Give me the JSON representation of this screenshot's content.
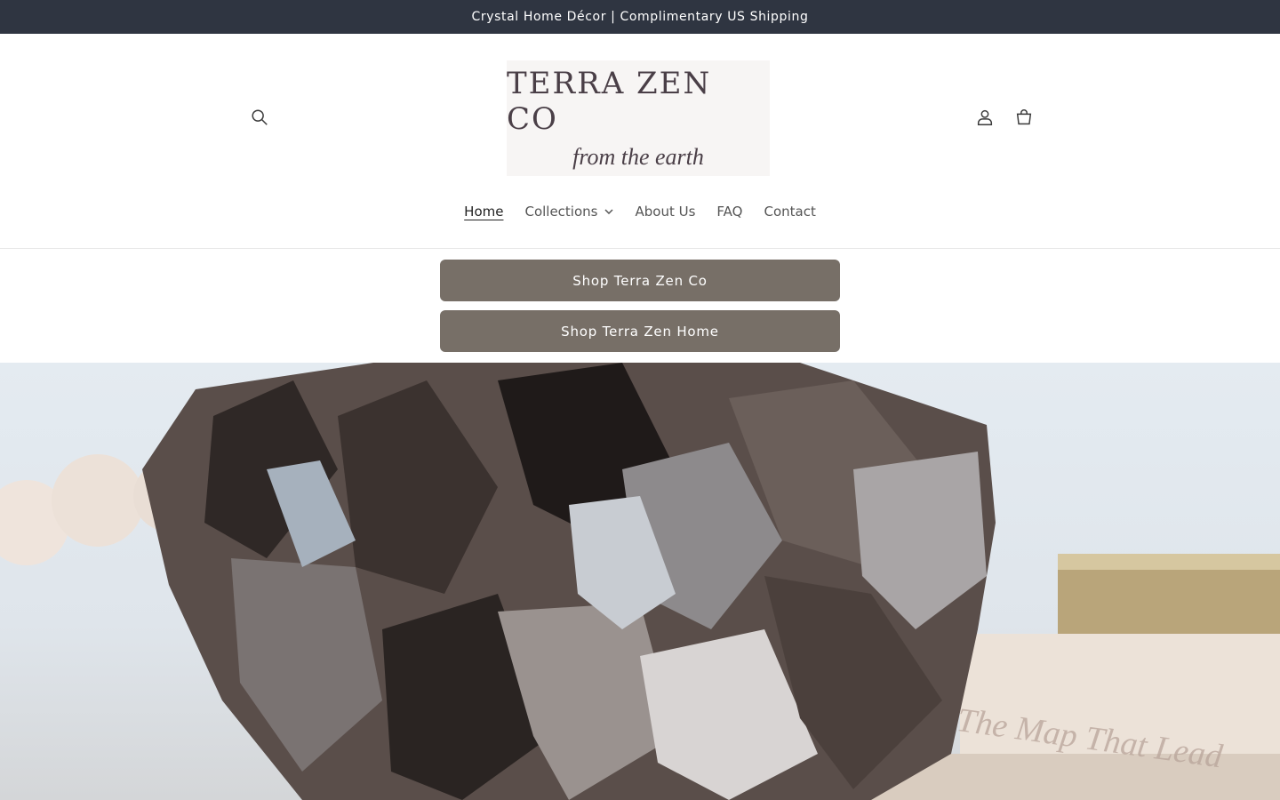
{
  "announcement": {
    "text": "Crystal Home Décor | Complimentary US Shipping"
  },
  "header": {
    "logo": {
      "title": "TERRA ZEN CO",
      "tagline": "from the earth"
    },
    "icons": {
      "search": "search-icon",
      "account": "account-icon",
      "cart": "cart-icon"
    }
  },
  "nav": {
    "items": [
      {
        "label": "Home",
        "active": true
      },
      {
        "label": "Collections",
        "has_dropdown": true
      },
      {
        "label": "About Us"
      },
      {
        "label": "FAQ"
      },
      {
        "label": "Contact"
      }
    ]
  },
  "buttons": {
    "shop_co": "Shop Terra Zen Co",
    "shop_home": "Shop Terra Zen Home"
  },
  "hero": {
    "book_text": "The Map That Lead"
  },
  "colors": {
    "announcement_bg": "#2f3541",
    "button_bg": "#776f67",
    "logo_text": "#4a3f47"
  }
}
